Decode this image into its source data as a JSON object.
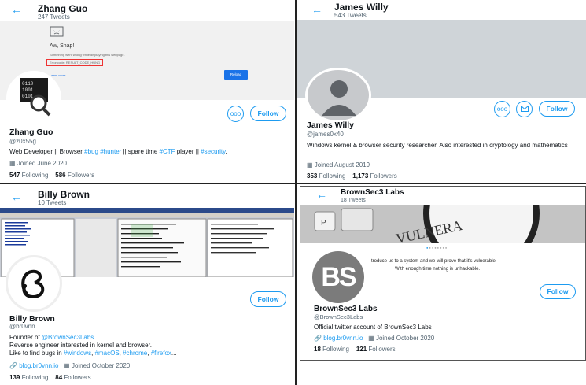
{
  "p1": {
    "header_name": "Zhang Guo",
    "header_count": "247 Tweets",
    "banner": {
      "title": "Aw, Snap!",
      "message": "Something went wrong while displaying this webpage.",
      "error_code": "Error code: RESULT_CODE_HUNG",
      "learn_more": "Learn more",
      "reload": "Reload"
    },
    "follow": "Follow",
    "more": "ooo",
    "name": "Zhang Guo",
    "handle": "@z0x55g",
    "bio_parts": [
      "Web Developer || Browser ",
      "#bug",
      " ",
      "#hunter",
      " || spare time ",
      "#CTF",
      " player || ",
      "#security",
      "."
    ],
    "joined": "Joined June 2020",
    "following_count": "547",
    "following_label": "Following",
    "followers_count": "586",
    "followers_label": "Followers"
  },
  "p2": {
    "header_name": "James Willy",
    "header_count": "543 Tweets",
    "follow": "Follow",
    "more": "ooo",
    "name": "James Willy",
    "handle": "@james0x40",
    "bio": "Windows kernel & browser security researcher. Also interested in cryptology and mathematics",
    "joined": "Joined August 2019",
    "following_count": "353",
    "following_label": "Following",
    "followers_count": "1,173",
    "followers_label": "Followers"
  },
  "p3": {
    "header_name": "Billy Brown",
    "header_count": "10 Tweets",
    "follow": "Follow",
    "name": "Billy Brown",
    "handle": "@br0vnn",
    "bio_line1_prefix": "Founder of ",
    "bio_line1_link": "@BrownSec3Labs",
    "bio_line2": "Reverse engineer interested in kernel and browser.",
    "bio_line3_prefix": "Like to find bugs in ",
    "bio_line3_tags": [
      "#windows",
      "#macOS",
      "#chrome",
      "#firefox"
    ],
    "bio_line3_suffix": "...",
    "link": "blog.br0vnn.io",
    "joined": "Joined October 2020",
    "following_count": "139",
    "following_label": "Following",
    "followers_count": "84",
    "followers_label": "Followers"
  },
  "p4": {
    "header_name": "BrownSec3 Labs",
    "header_count": "18 Tweets",
    "banner_word": "VULNERA",
    "banner_key": "P",
    "avatar_text": "BS",
    "promo_line1": "troduce us to a system and we will prove that it's vulnerable.",
    "promo_line2": "With enough time nothing is unhackable.",
    "follow": "Follow",
    "name": "BrownSec3 Labs",
    "handle": "@BrownSec3Labs",
    "bio": "Official twitter account of BrownSec3 Labs",
    "link": "blog.br0vnn.io",
    "joined": "Joined October 2020",
    "following_count": "18",
    "following_label": "Following",
    "followers_count": "121",
    "followers_label": "Followers"
  },
  "colors": {
    "accent": "#1d9bf0",
    "muted": "#536471",
    "text": "#0f1419"
  }
}
